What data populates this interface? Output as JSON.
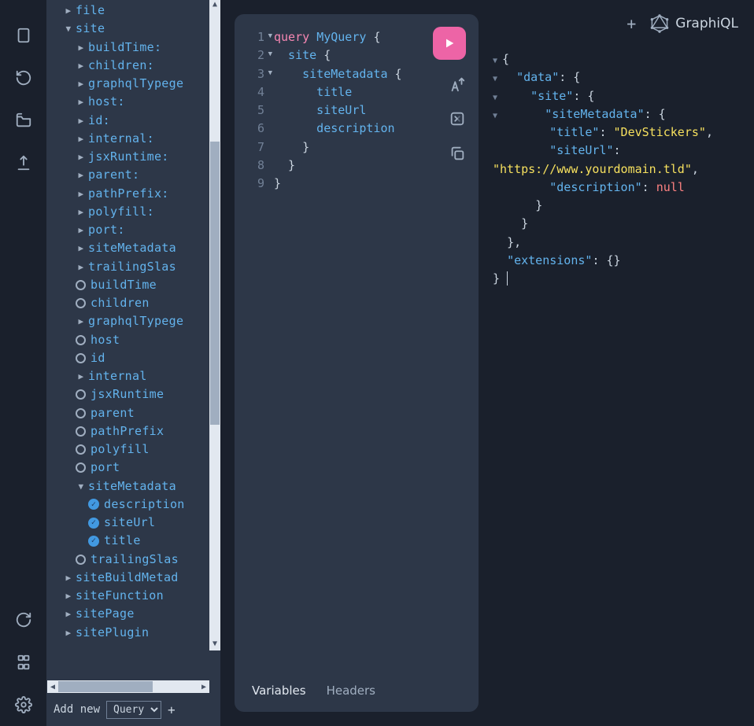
{
  "brand": "GraphiQL",
  "rail_icons": [
    "document-icon",
    "history-icon",
    "folder-icon",
    "export-icon",
    "refresh-icon",
    "keyboard-icon",
    "gear-icon"
  ],
  "explorer": {
    "rows": [
      {
        "depth": 1,
        "kind": "caret-right",
        "label": "file"
      },
      {
        "depth": 1,
        "kind": "caret-down",
        "label": "site"
      },
      {
        "depth": 2,
        "kind": "caret-right",
        "label": "buildTime:"
      },
      {
        "depth": 2,
        "kind": "caret-right",
        "label": "children:"
      },
      {
        "depth": 2,
        "kind": "caret-right",
        "label": "graphqlTypege"
      },
      {
        "depth": 2,
        "kind": "caret-right",
        "label": "host:"
      },
      {
        "depth": 2,
        "kind": "caret-right",
        "label": "id:"
      },
      {
        "depth": 2,
        "kind": "caret-right",
        "label": "internal:"
      },
      {
        "depth": 2,
        "kind": "caret-right",
        "label": "jsxRuntime:"
      },
      {
        "depth": 2,
        "kind": "caret-right",
        "label": "parent:"
      },
      {
        "depth": 2,
        "kind": "caret-right",
        "label": "pathPrefix:"
      },
      {
        "depth": 2,
        "kind": "caret-right",
        "label": "polyfill:"
      },
      {
        "depth": 2,
        "kind": "caret-right",
        "label": "port:"
      },
      {
        "depth": 2,
        "kind": "caret-right",
        "label": "siteMetadata"
      },
      {
        "depth": 2,
        "kind": "caret-right",
        "label": "trailingSlas"
      },
      {
        "depth": 2,
        "kind": "radio",
        "label": "buildTime"
      },
      {
        "depth": 2,
        "kind": "radio",
        "label": "children"
      },
      {
        "depth": 2,
        "kind": "caret-right",
        "label": "graphqlTypege"
      },
      {
        "depth": 2,
        "kind": "radio",
        "label": "host"
      },
      {
        "depth": 2,
        "kind": "radio",
        "label": "id"
      },
      {
        "depth": 2,
        "kind": "caret-right",
        "label": "internal"
      },
      {
        "depth": 2,
        "kind": "radio",
        "label": "jsxRuntime"
      },
      {
        "depth": 2,
        "kind": "radio",
        "label": "parent"
      },
      {
        "depth": 2,
        "kind": "radio",
        "label": "pathPrefix"
      },
      {
        "depth": 2,
        "kind": "radio",
        "label": "polyfill"
      },
      {
        "depth": 2,
        "kind": "radio",
        "label": "port"
      },
      {
        "depth": 2,
        "kind": "caret-down",
        "label": "siteMetadata"
      },
      {
        "depth": 3,
        "kind": "check",
        "label": "description"
      },
      {
        "depth": 3,
        "kind": "check",
        "label": "siteUrl"
      },
      {
        "depth": 3,
        "kind": "check",
        "label": "title"
      },
      {
        "depth": 2,
        "kind": "radio",
        "label": "trailingSlas"
      },
      {
        "depth": 1,
        "kind": "caret-right",
        "label": "siteBuildMetad"
      },
      {
        "depth": 1,
        "kind": "caret-right",
        "label": "siteFunction"
      },
      {
        "depth": 1,
        "kind": "caret-right",
        "label": "sitePage"
      },
      {
        "depth": 1,
        "kind": "caret-right",
        "label": "sitePlugin"
      }
    ],
    "add_new_label": "Add new",
    "add_new_option": "Query",
    "add_new_plus": "+"
  },
  "query": {
    "lines": [
      {
        "n": "1",
        "fold": true,
        "tokens": [
          {
            "t": "query ",
            "c": "kw"
          },
          {
            "t": "MyQuery ",
            "c": "name"
          },
          {
            "t": "{",
            "c": "punct"
          }
        ]
      },
      {
        "n": "2",
        "fold": true,
        "tokens": [
          {
            "t": "  site ",
            "c": "name"
          },
          {
            "t": "{",
            "c": "punct"
          }
        ]
      },
      {
        "n": "3",
        "fold": true,
        "tokens": [
          {
            "t": "    siteMetadata ",
            "c": "name"
          },
          {
            "t": "{",
            "c": "punct"
          }
        ]
      },
      {
        "n": "4",
        "tokens": [
          {
            "t": "      title",
            "c": "name"
          }
        ]
      },
      {
        "n": "5",
        "tokens": [
          {
            "t": "      siteUrl",
            "c": "name"
          }
        ]
      },
      {
        "n": "6",
        "tokens": [
          {
            "t": "      description",
            "c": "name"
          }
        ]
      },
      {
        "n": "7",
        "tokens": [
          {
            "t": "    }",
            "c": "punct"
          }
        ]
      },
      {
        "n": "8",
        "tokens": [
          {
            "t": "  }",
            "c": "punct"
          }
        ]
      },
      {
        "n": "9",
        "tokens": [
          {
            "t": "}",
            "c": "punct"
          }
        ]
      }
    ]
  },
  "bottom_tabs": {
    "variables": "Variables",
    "headers": "Headers"
  },
  "result": {
    "data_key": "data",
    "site_key": "site",
    "sitemeta_key": "siteMetadata",
    "title_key": "title",
    "title_val": "DevStickers",
    "siteurl_key": "siteUrl",
    "siteurl_val": "https://www.yourdomain.tld",
    "desc_key": "description",
    "desc_val": "null",
    "ext_key": "extensions"
  }
}
